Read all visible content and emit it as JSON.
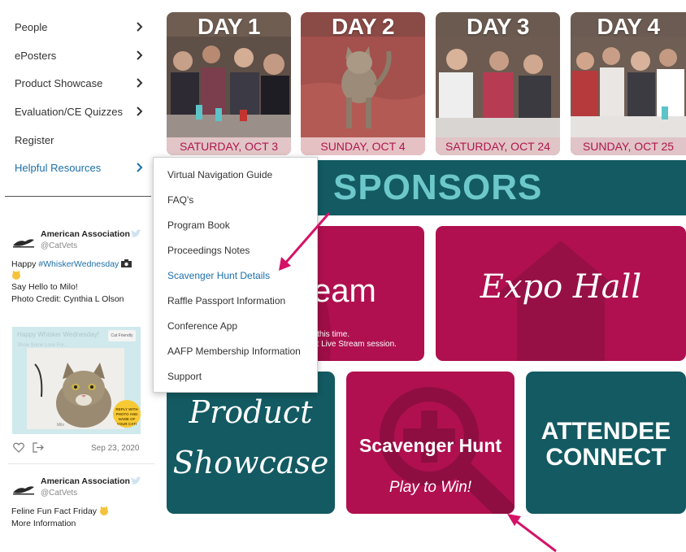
{
  "sidebar": {
    "items": [
      {
        "label": "People"
      },
      {
        "label": "ePosters"
      },
      {
        "label": "Product Showcase"
      },
      {
        "label": "Evaluation/CE Quizzes"
      },
      {
        "label": "Register"
      },
      {
        "label": "Helpful Resources"
      }
    ]
  },
  "dropdown": {
    "items": [
      {
        "label": "Virtual Navigation Guide"
      },
      {
        "label": "FAQ's"
      },
      {
        "label": "Program Book"
      },
      {
        "label": "Proceedings Notes"
      },
      {
        "label": "Scavenger Hunt Details"
      },
      {
        "label": "Raffle Passport Information"
      },
      {
        "label": "Conference App"
      },
      {
        "label": "AAFP Membership Information"
      },
      {
        "label": "Support"
      }
    ]
  },
  "feed": {
    "tweets": [
      {
        "name": "American Association of Feline Practitioners",
        "handle": "@CatVets",
        "line1_plain": "Happy ",
        "line1_tag": "#WhiskerWednesday",
        "line2": "Say Hello to Milo!",
        "line3": "Photo Credit: Cynthia L Olson",
        "image_title": "Happy Whisker Wednesday!",
        "image_sub": "Show Some Love For...",
        "image_logo": "Cat Friendly",
        "image_badge": "REPLY WITH PHOTO AND NAME OF YOUR CAT!",
        "image_caption": "Milo",
        "date": "Sep 23, 2020"
      },
      {
        "name": "American Association of Feline Practitioners",
        "handle": "@CatVets",
        "line1_plain": "Feline Fun Fact Friday",
        "line2": "More Information"
      }
    ]
  },
  "days": [
    {
      "label": "DAY 1",
      "date": "SATURDAY, OCT 3"
    },
    {
      "label": "DAY 2",
      "date": "SUNDAY, OCT 4"
    },
    {
      "label": "DAY 3",
      "date": "SATURDAY, OCT 24"
    },
    {
      "label": "DAY 4",
      "date": "SUNDAY, OCT 25"
    }
  ],
  "sponsors": {
    "label": "SPONSORS"
  },
  "tiles": {
    "livestream": {
      "title": "eam",
      "note1": "at this time.",
      "note2": "ext Live Stream session."
    },
    "expo": {
      "title": "Expo Hall"
    },
    "showcase": {
      "line1": "Product",
      "line2": "Showcase"
    },
    "scavenger": {
      "title": "Scavenger Hunt",
      "subtitle": "Play to Win!"
    },
    "attendee": {
      "line1": "ATTENDEE",
      "line2": "CONNECT"
    }
  },
  "colors": {
    "magenta": "#b0104f",
    "teal": "#135a62",
    "link_blue": "#1c6fa8",
    "arrow": "#d41367"
  }
}
